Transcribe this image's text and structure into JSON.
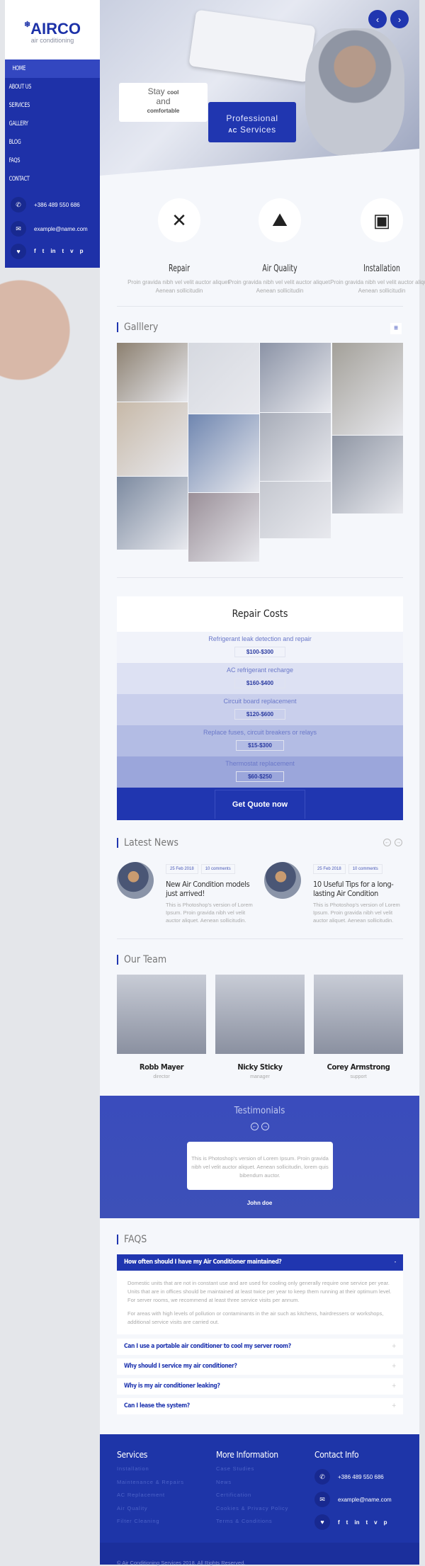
{
  "brand": {
    "name": "AIRCO",
    "tagline": "air conditioning"
  },
  "nav": [
    "HOME",
    "ABOUT US",
    "SERVICES",
    "GALLERY",
    "BLOG",
    "FAQS",
    "CONTACT"
  ],
  "contact": {
    "phone": "+386 489 550 686",
    "email": "example@name.com"
  },
  "social": [
    "f",
    "t",
    "in",
    "t",
    "v",
    "p"
  ],
  "hero": {
    "stay": "Stay",
    "cool": "cool",
    "and": "and",
    "comfortable": "comfortable",
    "professional": "Professional",
    "ac": "AC",
    "services": "Services",
    "prev": "‹",
    "next": "›"
  },
  "services": [
    {
      "title": "Repair",
      "desc": "Proin gravida nibh vel velit auctor aliquet. Aenean sollicitudin",
      "icon": "✕"
    },
    {
      "title": "Air Quality",
      "desc": "Proin gravida nibh vel velit auctor aliquet. Aenean sollicitudin",
      "icon": "⛰"
    },
    {
      "title": "Installation",
      "desc": "Proin gravida nibh vel velit auctor aliquet. Aenean sollicitudin",
      "icon": "▣"
    }
  ],
  "gallery": {
    "title": "Galllery",
    "menu_icon": "≡"
  },
  "costs": {
    "title": "Repair Costs",
    "items": [
      {
        "label": "Refrigerant leak detection and repair",
        "price": "$100-$300"
      },
      {
        "label": "AC refrigerant recharge",
        "price": "$160-$400"
      },
      {
        "label": "Circuit board replacement",
        "price": "$120-$600"
      },
      {
        "label": "Replace fuses, circuit breakers or relays",
        "price": "$15-$300"
      },
      {
        "label": "Thermostat replacement",
        "price": "$60-$250"
      }
    ],
    "cta": "Get Quote now"
  },
  "news": {
    "title": "Latest News",
    "items": [
      {
        "date": "25 Feb 2018",
        "comments": "10 comments",
        "title": "New Air Condition models just arrived!",
        "desc": "This is Photoshop's version of Lorem Ipsum. Proin gravida nibh vel velit auctor aliquet. Aenean sollicitudin."
      },
      {
        "date": "25 Feb 2018",
        "comments": "10 comments",
        "title": "10 Useful Tips for a long-lasting Air Condition",
        "desc": "This is Photoshop's version of Lorem Ipsum. Proin gravida nibh vel velit auctor aliquet. Aenean sollicitudin."
      }
    ]
  },
  "team": {
    "title": "Our Team",
    "members": [
      {
        "name": "Robb Mayer",
        "role": "director"
      },
      {
        "name": "Nicky Sticky",
        "role": "manager"
      },
      {
        "name": "Corey Armstrong",
        "role": "support"
      }
    ]
  },
  "testimonials": {
    "title": "Testimonials",
    "text": "This is Photoshop's version of Lorem Ipsum. Proin gravida nibh vel velit auctor aliquet. Aenean sollicitudin, lorem quis bibendum auctor.",
    "author": "John doe"
  },
  "faqs": {
    "title": "FAQS",
    "items": [
      {
        "q": "How often should I have my Air Conditioner maintained?",
        "sign": "-"
      },
      {
        "q": "Can I use a portable air conditioner to cool my server room?",
        "sign": "+"
      },
      {
        "q": "Why should I service my air conditioner?",
        "sign": "+"
      },
      {
        "q": "Why is my air conditioner leaking?",
        "sign": "+"
      },
      {
        "q": "Can I lease the system?",
        "sign": "+"
      }
    ],
    "answer1": "Domestic units that are not in constant use and are used for cooling only generally require one service per year. Units that are in offices should be maintained at least twice per year to keep them running at their optimum level. For server rooms, we recommend at least three service visits per annum.",
    "answer2": "For areas with high levels of pollution or contaminants in the air such as kitchens, hairdressers or workshops, additional service visits are carried out."
  },
  "footer": {
    "services_title": "Services",
    "services": [
      "Installation",
      "Maintenance & Repairs",
      "AC Replacement",
      "Air Quality",
      "Filter Cleaning"
    ],
    "info_title": "More Information",
    "info": [
      "Case Studies",
      "News",
      "Certification",
      "Cookies & Privacy Policy",
      "Terms & Conditions"
    ],
    "contact_title": "Contact Info",
    "copyright": "© Air Conditioning Services 2018. All Rights Reserved."
  },
  "colors": {
    "primary": "#1e31a8",
    "background": "#f5f7fb"
  }
}
